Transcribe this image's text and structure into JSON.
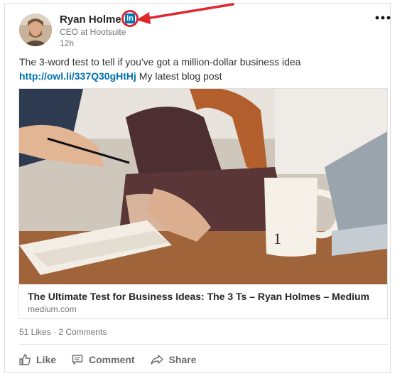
{
  "author": {
    "name": "Ryan Holmes",
    "title": "CEO at Hootsuite",
    "time": "12h",
    "badge_text": "in"
  },
  "post": {
    "text": "The 3-word test to tell if you've got a million-dollar business idea",
    "link": "http://owl.li/337Q30gHtHj",
    "link_suffix": "My latest blog post"
  },
  "article": {
    "title": "The Ultimate Test for Business Ideas: The 3 Ts – Ryan Holmes – Medium",
    "source": "medium.com",
    "mug_text": "1"
  },
  "social": {
    "counts": "51 Likes · 2 Comments"
  },
  "actions": {
    "like": "Like",
    "comment": "Comment",
    "share": "Share"
  },
  "colors": {
    "link": "#0073b1",
    "linkedin_blue": "#0077b5",
    "annotation_red": "#e0262d"
  },
  "icons": [
    "linkedin-icon",
    "more-options-icon",
    "thumbs-up-icon",
    "comment-icon",
    "share-icon",
    "annotation-arrow-icon"
  ]
}
